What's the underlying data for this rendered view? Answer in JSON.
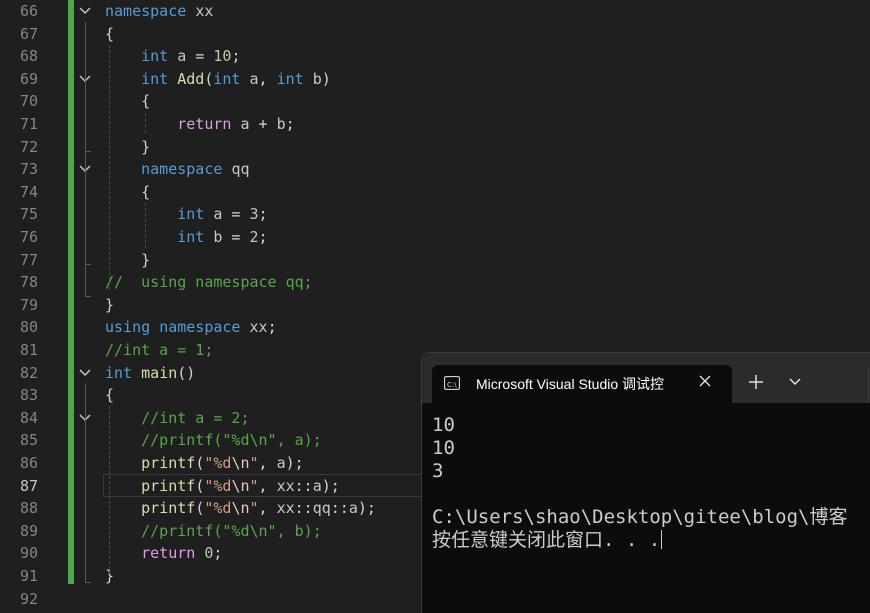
{
  "editor": {
    "lines": [
      {
        "n": "66",
        "t": [
          [
            "kw",
            "namespace"
          ],
          [
            "pl",
            " "
          ],
          [
            "gray",
            "xx"
          ]
        ]
      },
      {
        "n": "67",
        "t": [
          [
            "pl",
            "{"
          ]
        ]
      },
      {
        "n": "68",
        "t": [
          [
            "pl",
            "    "
          ],
          [
            "ty",
            "int"
          ],
          [
            "pl",
            " "
          ],
          [
            "gray",
            "a"
          ],
          [
            "pl",
            " = "
          ],
          [
            "num",
            "10"
          ],
          [
            "pl",
            ";"
          ]
        ]
      },
      {
        "n": "69",
        "t": [
          [
            "pl",
            "    "
          ],
          [
            "ty",
            "int"
          ],
          [
            "pl",
            " "
          ],
          [
            "fn",
            "Add"
          ],
          [
            "pl",
            "("
          ],
          [
            "ty",
            "int"
          ],
          [
            "pl",
            " "
          ],
          [
            "gray",
            "a"
          ],
          [
            "pl",
            ", "
          ],
          [
            "ty",
            "int"
          ],
          [
            "pl",
            " "
          ],
          [
            "gray",
            "b"
          ],
          [
            "pl",
            ")"
          ]
        ]
      },
      {
        "n": "70",
        "t": [
          [
            "pl",
            "    {"
          ]
        ]
      },
      {
        "n": "71",
        "t": [
          [
            "pl",
            "        "
          ],
          [
            "ctl",
            "return"
          ],
          [
            "pl",
            " "
          ],
          [
            "gray",
            "a"
          ],
          [
            "pl",
            " + "
          ],
          [
            "gray",
            "b"
          ],
          [
            "pl",
            ";"
          ]
        ]
      },
      {
        "n": "72",
        "t": [
          [
            "pl",
            "    }"
          ]
        ]
      },
      {
        "n": "73",
        "t": [
          [
            "pl",
            "    "
          ],
          [
            "kw",
            "namespace"
          ],
          [
            "pl",
            " "
          ],
          [
            "gray",
            "qq"
          ]
        ]
      },
      {
        "n": "74",
        "t": [
          [
            "pl",
            "    {"
          ]
        ]
      },
      {
        "n": "75",
        "t": [
          [
            "pl",
            "        "
          ],
          [
            "ty",
            "int"
          ],
          [
            "pl",
            " "
          ],
          [
            "gray",
            "a"
          ],
          [
            "pl",
            " = "
          ],
          [
            "num",
            "3"
          ],
          [
            "pl",
            ";"
          ]
        ]
      },
      {
        "n": "76",
        "t": [
          [
            "pl",
            "        "
          ],
          [
            "ty",
            "int"
          ],
          [
            "pl",
            " "
          ],
          [
            "gray",
            "b"
          ],
          [
            "pl",
            " = "
          ],
          [
            "num",
            "2"
          ],
          [
            "pl",
            ";"
          ]
        ]
      },
      {
        "n": "77",
        "t": [
          [
            "pl",
            "    }"
          ]
        ]
      },
      {
        "n": "78",
        "t": [
          [
            "cm",
            "//  using namespace qq;"
          ]
        ]
      },
      {
        "n": "79",
        "t": [
          [
            "pl",
            "}"
          ]
        ]
      },
      {
        "n": "80",
        "t": [
          [
            "kw",
            "using"
          ],
          [
            "pl",
            " "
          ],
          [
            "kw",
            "namespace"
          ],
          [
            "pl",
            " "
          ],
          [
            "gray",
            "xx"
          ],
          [
            "pl",
            ";"
          ]
        ]
      },
      {
        "n": "81",
        "t": [
          [
            "cm",
            "//int a = 1;"
          ]
        ]
      },
      {
        "n": "82",
        "t": [
          [
            "ty",
            "int"
          ],
          [
            "pl",
            " "
          ],
          [
            "fn",
            "main"
          ],
          [
            "pl",
            "()"
          ]
        ]
      },
      {
        "n": "83",
        "t": [
          [
            "pl",
            "{"
          ]
        ]
      },
      {
        "n": "84",
        "t": [
          [
            "pl",
            "    "
          ],
          [
            "cm",
            "//int a = 2;"
          ]
        ]
      },
      {
        "n": "85",
        "t": [
          [
            "pl",
            "    "
          ],
          [
            "cm",
            "//printf(\"%d\\n\", a);"
          ]
        ]
      },
      {
        "n": "86",
        "t": [
          [
            "pl",
            "    "
          ],
          [
            "fn",
            "printf"
          ],
          [
            "pl",
            "("
          ],
          [
            "str",
            "\"%d"
          ],
          [
            "esc",
            "\\n"
          ],
          [
            "str",
            "\""
          ],
          [
            "pl",
            ", "
          ],
          [
            "gray",
            "a"
          ],
          [
            "pl",
            ");"
          ]
        ]
      },
      {
        "n": "87",
        "t": [
          [
            "pl",
            "    "
          ],
          [
            "fn",
            "printf"
          ],
          [
            "pl",
            "("
          ],
          [
            "str",
            "\"%d"
          ],
          [
            "esc",
            "\\n"
          ],
          [
            "str",
            "\""
          ],
          [
            "pl",
            ", "
          ],
          [
            "gray",
            "xx"
          ],
          [
            "pl",
            "::"
          ],
          [
            "gray",
            "a"
          ],
          [
            "pl",
            ");"
          ]
        ]
      },
      {
        "n": "88",
        "t": [
          [
            "pl",
            "    "
          ],
          [
            "fn",
            "printf"
          ],
          [
            "pl",
            "("
          ],
          [
            "str",
            "\"%d"
          ],
          [
            "esc",
            "\\n"
          ],
          [
            "str",
            "\""
          ],
          [
            "pl",
            ", "
          ],
          [
            "gray",
            "xx"
          ],
          [
            "pl",
            "::"
          ],
          [
            "gray",
            "qq"
          ],
          [
            "pl",
            "::"
          ],
          [
            "gray",
            "a"
          ],
          [
            "pl",
            ");"
          ]
        ]
      },
      {
        "n": "89",
        "t": [
          [
            "pl",
            "    "
          ],
          [
            "cm",
            "//printf(\"%d\\n\", b);"
          ]
        ]
      },
      {
        "n": "90",
        "t": [
          [
            "pl",
            "    "
          ],
          [
            "ctl",
            "return"
          ],
          [
            "pl",
            " "
          ],
          [
            "num",
            "0"
          ],
          [
            "pl",
            ";"
          ]
        ]
      },
      {
        "n": "91",
        "t": [
          [
            "pl",
            "}"
          ]
        ]
      },
      {
        "n": "92",
        "t": []
      }
    ],
    "active_line": "87",
    "fold_lines": [
      "66",
      "69",
      "73",
      "82",
      "84"
    ]
  },
  "terminal": {
    "tab_title": "Microsoft Visual Studio 调试控",
    "tab_icon": "console-icon",
    "close_icon": "close-icon",
    "new_tab_icon": "plus-icon",
    "dropdown_icon": "chevron-down-icon",
    "output": [
      "10",
      "10",
      "3",
      "",
      "C:\\Users\\shao\\Desktop\\gitee\\blog\\博客",
      "按任意键关闭此窗口. . ."
    ]
  },
  "colors": {
    "accent_green": "#4ca84e",
    "editor_bg": "#1f1f1f",
    "terminal_bg": "#0c0c0c"
  }
}
